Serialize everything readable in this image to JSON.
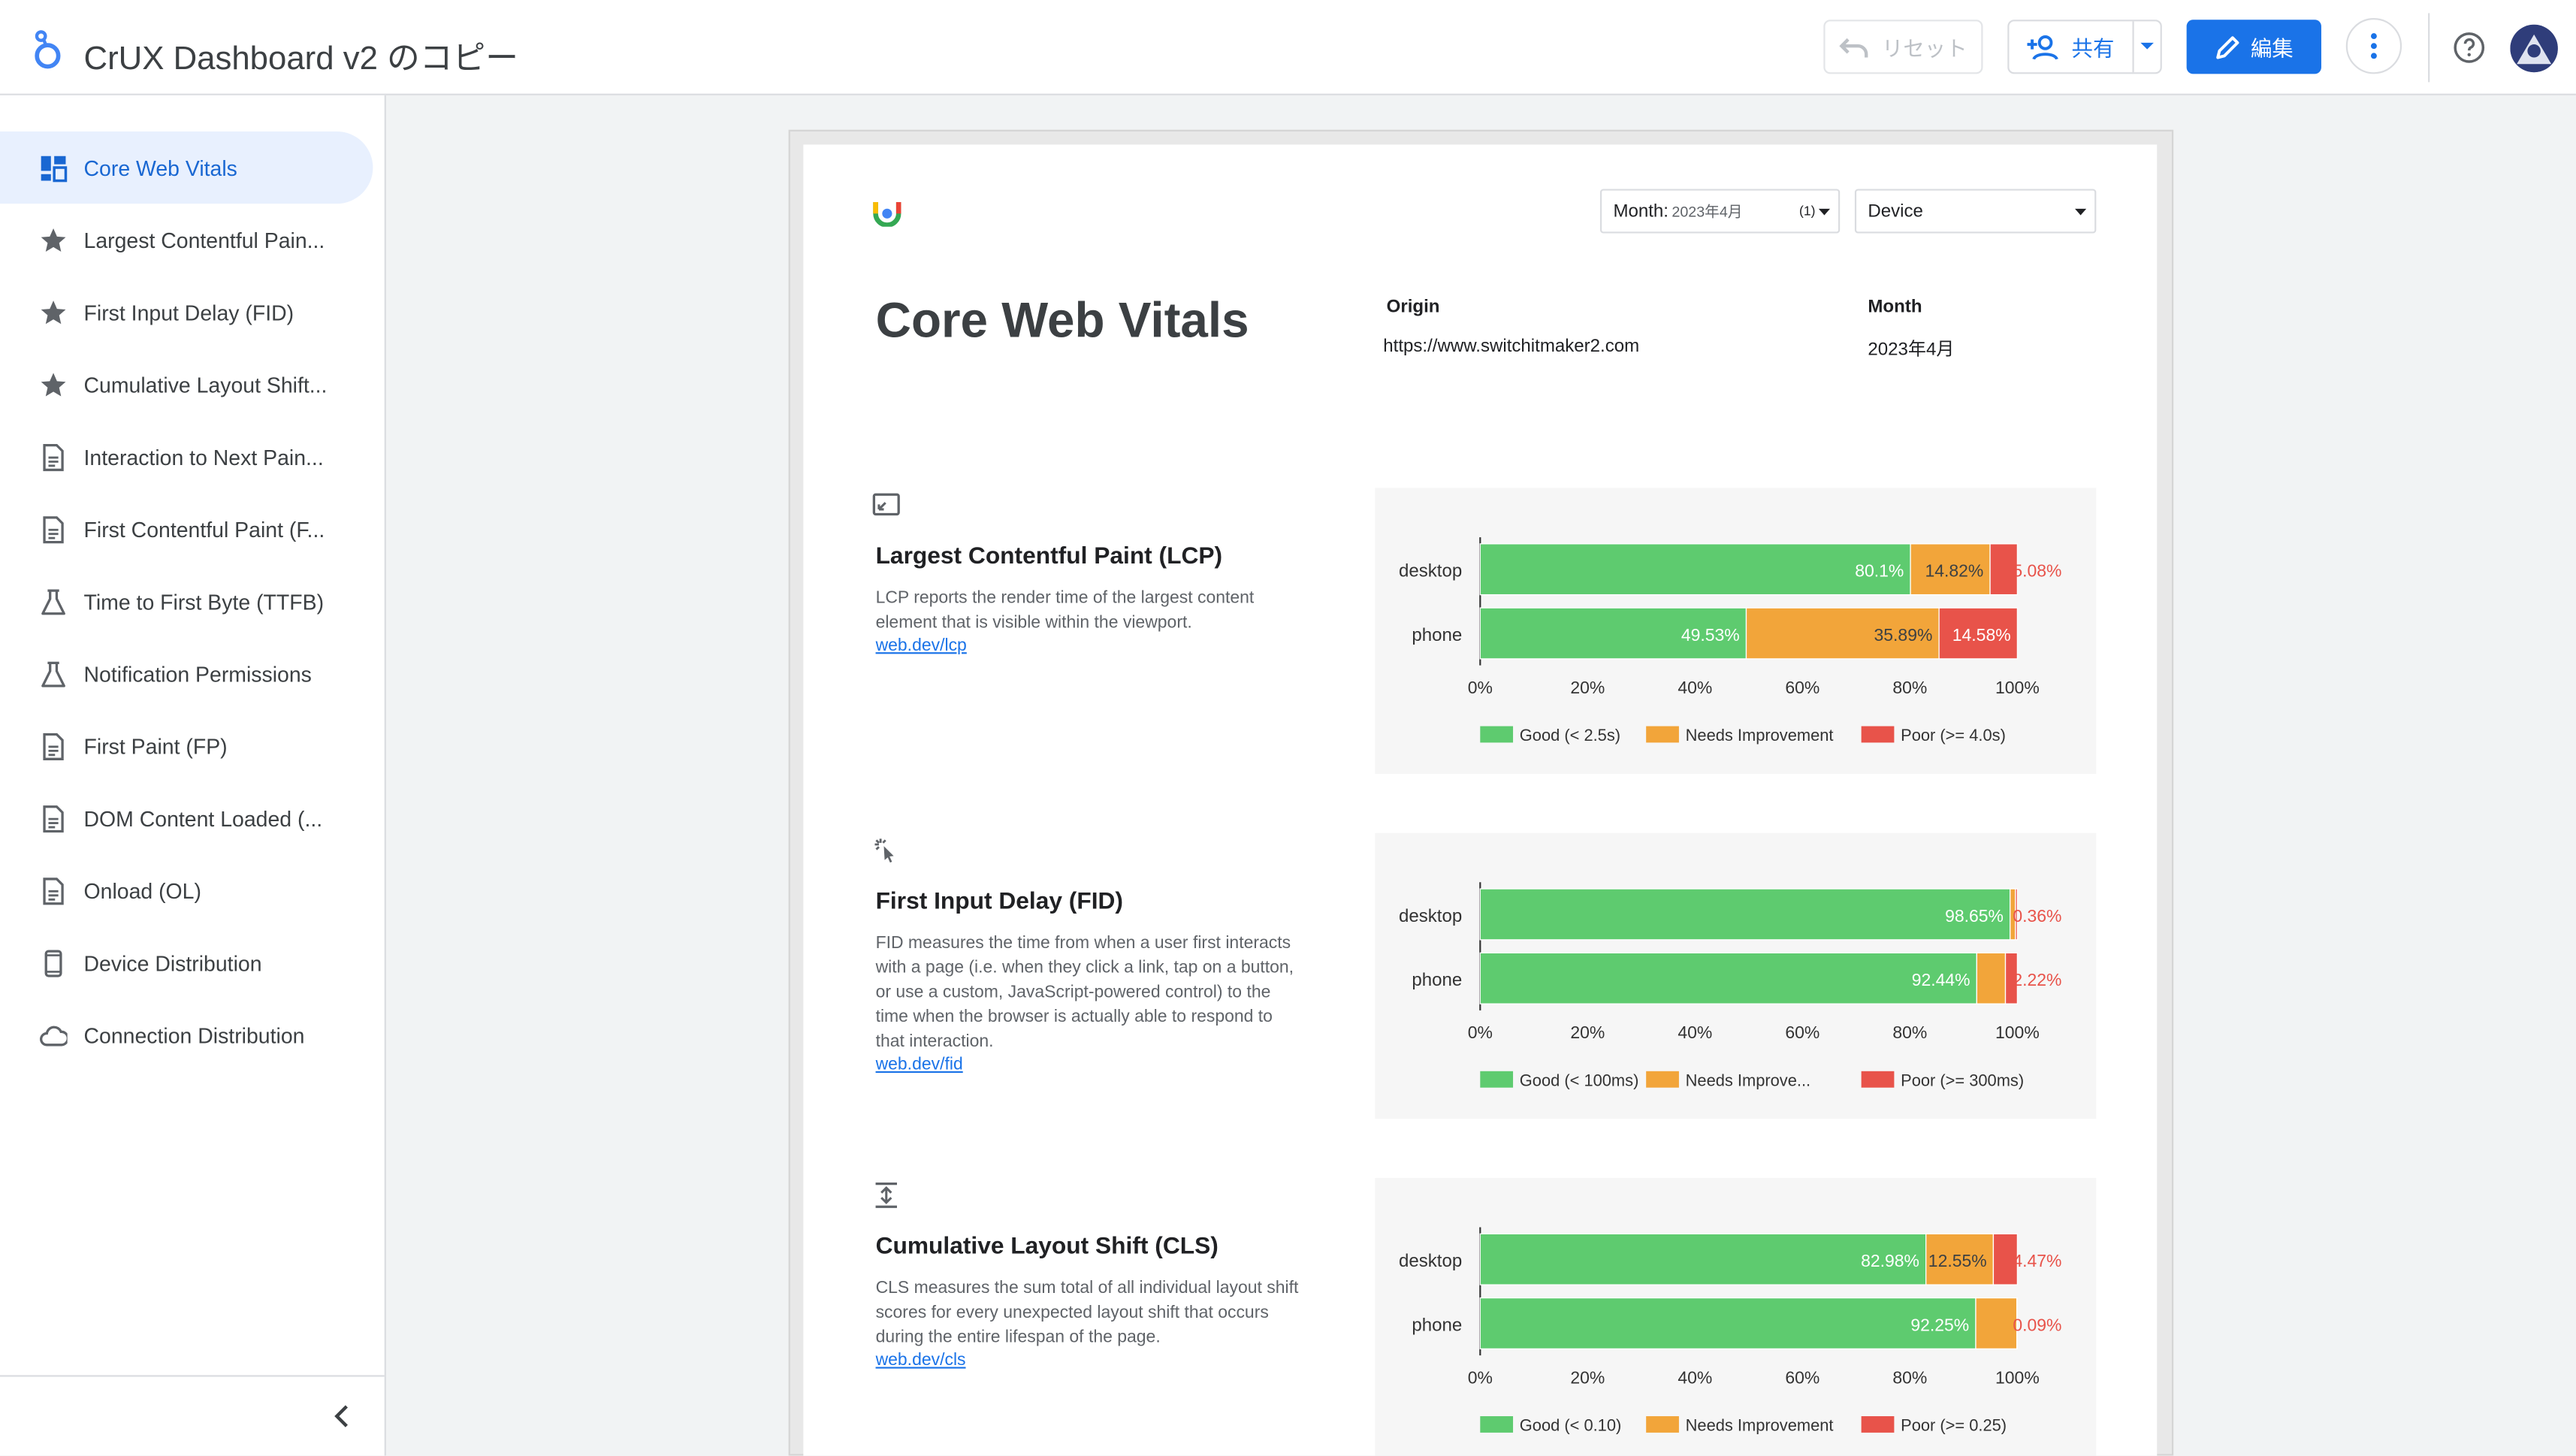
{
  "app": {
    "title": "CrUX Dashboard v2 のコピー",
    "reset_label": "リセット",
    "share_label": "共有",
    "edit_label": "編集"
  },
  "sidebar": {
    "items": [
      {
        "label": "Core Web Vitals",
        "icon": "dashboard-icon",
        "active": true
      },
      {
        "label": "Largest Contentful Pain...",
        "icon": "star-icon"
      },
      {
        "label": "First Input Delay (FID)",
        "icon": "star-icon"
      },
      {
        "label": "Cumulative Layout Shift...",
        "icon": "star-icon"
      },
      {
        "label": "Interaction to Next Pain...",
        "icon": "document-icon"
      },
      {
        "label": "First Contentful Paint (F...",
        "icon": "document-icon"
      },
      {
        "label": "Time to First Byte (TTFB)",
        "icon": "flask-icon"
      },
      {
        "label": "Notification Permissions",
        "icon": "flask-icon"
      },
      {
        "label": "First Paint (FP)",
        "icon": "document-icon"
      },
      {
        "label": "DOM Content Loaded (...",
        "icon": "document-icon"
      },
      {
        "label": "Onload (OL)",
        "icon": "document-icon"
      },
      {
        "label": "Device Distribution",
        "icon": "phone-icon"
      },
      {
        "label": "Connection Distribution",
        "icon": "cloud-icon"
      }
    ]
  },
  "report": {
    "title": "Core Web Vitals",
    "controls": {
      "month_label": "Month:",
      "month_value": "2023年4月",
      "month_count": "(1)",
      "device_label": "Device"
    },
    "origin_label": "Origin",
    "origin_value": "https://www.switchitmaker2.com",
    "month_label": "Month",
    "month_value": "2023年4月"
  },
  "colors": {
    "good": "#5ecb6f",
    "needs_improvement": "#f2a53a",
    "poor": "#e8534a",
    "accent": "#1a73e8"
  },
  "sections": [
    {
      "icon": "lcp-icon",
      "title": "Largest Contentful Paint (LCP)",
      "description": "LCP reports the render time of the largest content element that is visible within the viewport.",
      "link": "web.dev/lcp"
    },
    {
      "icon": "fid-icon",
      "title": "First Input Delay (FID)",
      "description": "FID measures the time from when a user first interacts with a page (i.e. when they click a link, tap on a button, or use a custom, JavaScript-powered control) to the time when the browser is actually able to respond to that interaction.",
      "link": "web.dev/fid"
    },
    {
      "icon": "cls-icon",
      "title": "Cumulative Layout Shift (CLS)",
      "description": "CLS measures the sum total of all individual layout shift scores for every unexpected layout shift that occurs during the entire lifespan of the page.",
      "link": "web.dev/cls"
    }
  ],
  "chart_data": [
    {
      "type": "bar",
      "orientation": "horizontal",
      "stacked": true,
      "categories": [
        "desktop",
        "phone"
      ],
      "series": [
        {
          "name": "Good (< 2.5s)",
          "values": [
            80.1,
            49.53
          ],
          "labels": [
            "80.1%",
            "49.53%"
          ]
        },
        {
          "name": "Needs Improvement",
          "values": [
            14.82,
            35.89
          ],
          "labels": [
            "14.82%",
            "35.89%"
          ]
        },
        {
          "name": "Poor (>= 4.0s)",
          "values": [
            5.08,
            14.58
          ],
          "labels": [
            "5.08%",
            "14.58%"
          ]
        }
      ],
      "x_ticks": [
        "0%",
        "20%",
        "40%",
        "60%",
        "80%",
        "100%"
      ],
      "xlim": [
        0,
        100
      ],
      "legend": "bottom"
    },
    {
      "type": "bar",
      "orientation": "horizontal",
      "stacked": true,
      "categories": [
        "desktop",
        "phone"
      ],
      "series": [
        {
          "name": "Good (< 100ms)",
          "values": [
            98.65,
            92.44
          ],
          "labels": [
            "98.65%",
            "92.44%"
          ]
        },
        {
          "name": "Needs Improve...",
          "values": [
            0.99,
            5.34
          ],
          "labels": [
            "",
            ""
          ]
        },
        {
          "name": "Poor (>= 300ms)",
          "values": [
            0.36,
            2.22
          ],
          "labels": [
            "0.36%",
            "2.22%"
          ]
        }
      ],
      "x_ticks": [
        "0%",
        "20%",
        "40%",
        "60%",
        "80%",
        "100%"
      ],
      "xlim": [
        0,
        100
      ],
      "legend": "bottom"
    },
    {
      "type": "bar",
      "orientation": "horizontal",
      "stacked": true,
      "categories": [
        "desktop",
        "phone"
      ],
      "series": [
        {
          "name": "Good (< 0.10)",
          "values": [
            82.98,
            92.25
          ],
          "labels": [
            "82.98%",
            "92.25%"
          ]
        },
        {
          "name": "Needs Improvement",
          "values": [
            12.55,
            7.66
          ],
          "labels": [
            "12.55%",
            ""
          ]
        },
        {
          "name": "Poor (>= 0.25)",
          "values": [
            4.47,
            0.09
          ],
          "labels": [
            "4.47%",
            "0.09%"
          ]
        }
      ],
      "x_ticks": [
        "0%",
        "20%",
        "40%",
        "60%",
        "80%",
        "100%"
      ],
      "xlim": [
        0,
        100
      ],
      "legend": "bottom"
    }
  ]
}
